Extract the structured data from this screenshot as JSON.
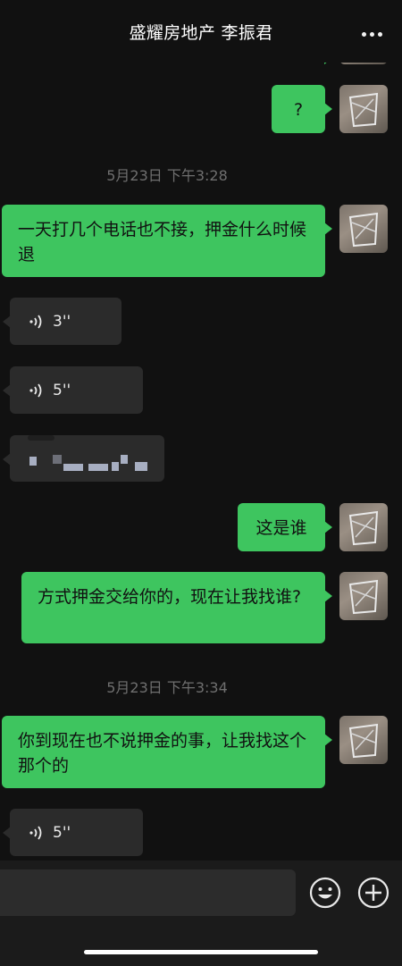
{
  "header": {
    "title": "盛耀房地产 李振君",
    "more_icon": "ellipsis-icon"
  },
  "messages": {
    "m1": {
      "text": "?"
    },
    "ts1": {
      "text": "5月23日 下午3:28"
    },
    "m2": {
      "text": "一天打几个电话也不接，押金什么时候退"
    },
    "v1": {
      "duration": "3''"
    },
    "v2": {
      "duration": "5''"
    },
    "m3": {
      "text": "这是谁"
    },
    "m4": {
      "text": "方式押金交给你的，现在让我找谁?"
    },
    "ts2": {
      "text": "5月23日 下午3:34"
    },
    "m5": {
      "text": "你到现在也不说押金的事，让我找这个那个的"
    },
    "v3": {
      "duration": "5''"
    }
  },
  "input_bar": {
    "emoji_icon": "emoji-icon",
    "add_icon": "plus-circle-icon"
  },
  "colors": {
    "bubble_green": "#3ec55f",
    "bubble_gray": "#2b2b2b",
    "background": "#111111"
  }
}
